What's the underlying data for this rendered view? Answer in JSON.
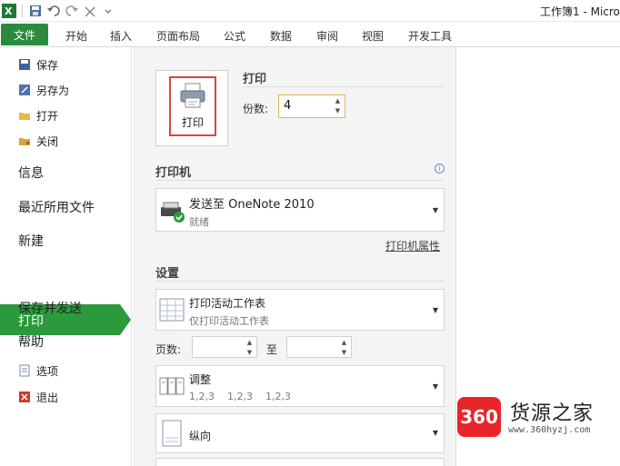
{
  "window": {
    "title": "工作簿1 - Micro"
  },
  "ribbon": {
    "file_tab": "文件",
    "tabs": [
      "开始",
      "插入",
      "页面布局",
      "公式",
      "数据",
      "审阅",
      "视图",
      "开发工具"
    ]
  },
  "nav": {
    "save": "保存",
    "save_as": "另存为",
    "open": "打开",
    "close": "关闭",
    "info": "信息",
    "recent": "最近所用文件",
    "new": "新建",
    "print": "打印",
    "save_send": "保存并发送",
    "help": "帮助",
    "options": "选项",
    "exit": "退出"
  },
  "print": {
    "section_title": "打印",
    "button_label": "打印",
    "copies_label": "份数:",
    "copies_value": "4"
  },
  "printer": {
    "section_title": "打印机",
    "name": "发送至 OneNote 2010",
    "status": "就绪",
    "properties_link": "打印机属性"
  },
  "settings": {
    "section_title": "设置",
    "scope_main": "打印活动工作表",
    "scope_sub": "仅打印活动工作表",
    "pages_label": "页数:",
    "to_label": "至",
    "collate_main": "调整",
    "collate_sub": "1,2,3    1,2,3    1,2,3",
    "orientation": "纵向"
  },
  "watermark": {
    "badge": "360",
    "title": "货源之家",
    "url": "www.360hyzj.com"
  },
  "colors": {
    "file_tab": "#2b8a3e",
    "nav_active": "#2b9a3c",
    "highlight": "#d9463e",
    "watermark": "#e8262a"
  }
}
